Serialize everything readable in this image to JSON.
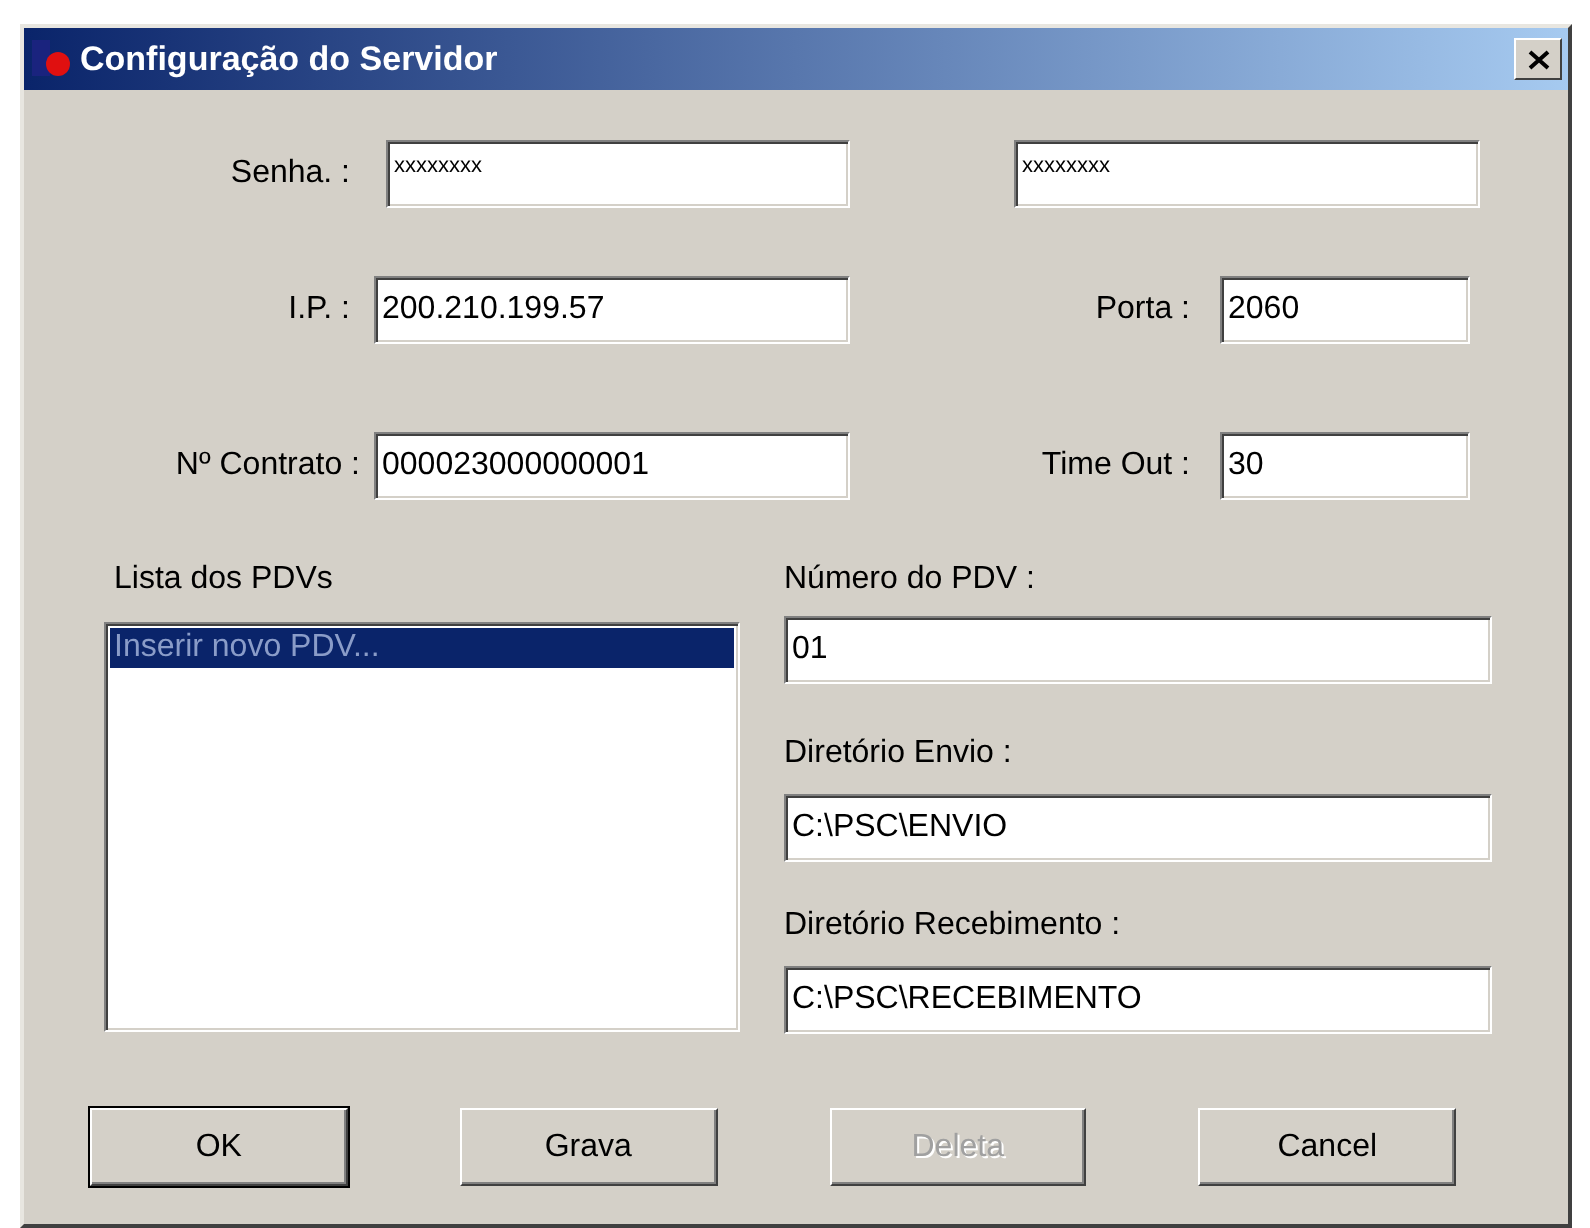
{
  "window": {
    "title": "Configuração do Servidor"
  },
  "password": {
    "label": "Senha. :",
    "value": "xxxxxxxx",
    "confirm_value": "xxxxxxxx"
  },
  "ip": {
    "label": "I.P. :",
    "value": "200.210.199.57"
  },
  "port": {
    "label": "Porta :",
    "value": "2060"
  },
  "contract": {
    "label": "Nº Contrato :",
    "value": "000023000000001"
  },
  "timeout": {
    "label": "Time Out :",
    "value": "30"
  },
  "pdv_list": {
    "label": "Lista dos PDVs",
    "items": [
      {
        "text": "Inserir novo PDV...",
        "selected": true
      }
    ]
  },
  "pdv_fields": [
    {
      "label": "Número do PDV :",
      "value": "01"
    },
    {
      "label": "Diretório Envio :",
      "value": "C:\\PSC\\ENVIO"
    },
    {
      "label": "Diretório Recebimento :",
      "value": "C:\\PSC\\RECEBIMENTO"
    }
  ],
  "buttons": [
    {
      "label": "OK",
      "disabled": false,
      "default": true
    },
    {
      "label": "Grava",
      "disabled": false,
      "default": false
    },
    {
      "label": "Deleta",
      "disabled": true,
      "default": false
    },
    {
      "label": "Cancel",
      "disabled": false,
      "default": false
    }
  ]
}
